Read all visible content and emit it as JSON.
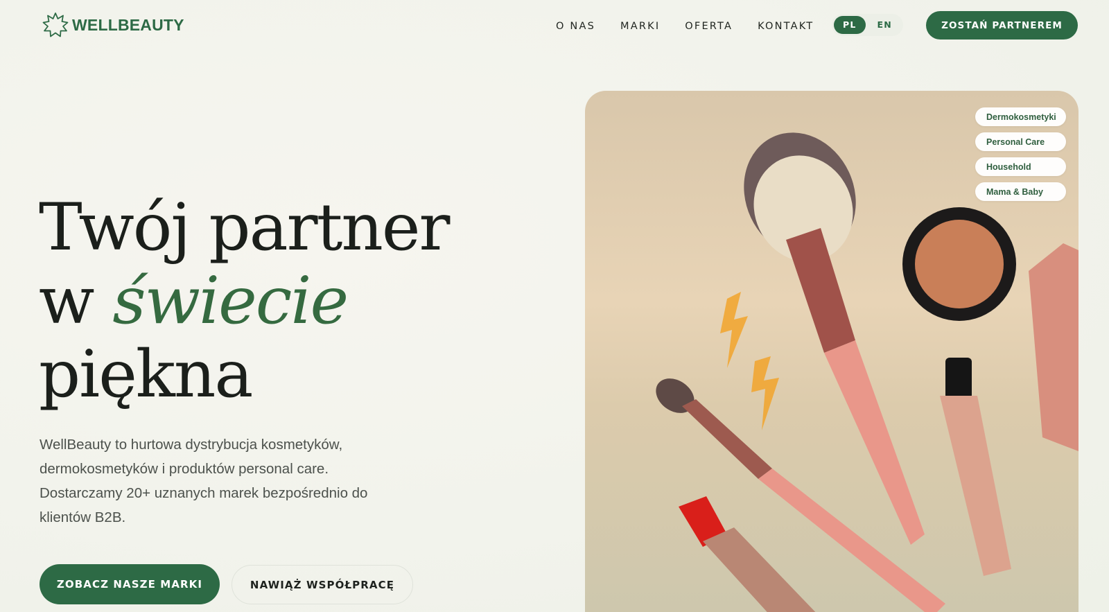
{
  "header": {
    "logo_text": "WELLBEAUTY",
    "logo_icon": "flower-outline-icon",
    "nav": [
      {
        "label": "O NAS"
      },
      {
        "label": "MARKI"
      },
      {
        "label": "OFERTA"
      },
      {
        "label": "KONTAKT"
      }
    ],
    "languages": [
      {
        "label": "PL",
        "active": true
      },
      {
        "label": "EN",
        "active": false
      }
    ],
    "cta_label": "ZOSTAŃ PARTNEREM"
  },
  "hero": {
    "title_line1": "Twój partner",
    "title_line2_prefix": "w ",
    "title_line2_accent": "świecie",
    "title_line3": "piękna",
    "description": "WellBeauty to hurtowa dystrybucja kosmetyków, dermokosmetyków i produktów personal care. Dostarczamy 20+ uznanych marek bezpośrednio do klientów B2B.",
    "primary_button": "ZOBACZ NASZE MARKI",
    "secondary_button": "NAWIĄŻ WSPÓŁPRACĘ",
    "categories": [
      "Dermokosmetyki",
      "Personal Care",
      "Household",
      "Mama & Baby"
    ]
  },
  "colors": {
    "brand_green": "#2d6a45",
    "accent_green": "#356a40",
    "background": "#f3f4ee"
  }
}
